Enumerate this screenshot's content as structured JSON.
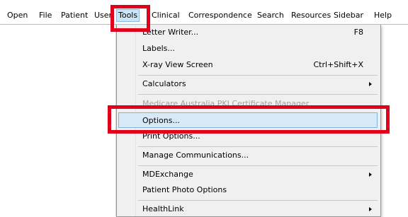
{
  "menubar": {
    "items": [
      "Open",
      "File",
      "Patient",
      "User",
      "Tools",
      "Clinical",
      "Correspondence",
      "Search",
      "Resources",
      "Sidebar",
      "Help"
    ]
  },
  "tools_menu": {
    "letter_writer": {
      "label": "Letter Writer...",
      "shortcut": "F8"
    },
    "labels": {
      "label": "Labels..."
    },
    "xray_view": {
      "label": "X-ray View Screen",
      "shortcut": "Ctrl+Shift+X"
    },
    "calculators": {
      "label": "Calculators"
    },
    "medicare_pki": {
      "label": "Medicare Australia PKI Certificate Manager"
    },
    "options": {
      "label": "Options..."
    },
    "print_options": {
      "label": "Print Options..."
    },
    "manage_comms": {
      "label": "Manage Communications..."
    },
    "mdexchange": {
      "label": "MDExchange"
    },
    "patient_photo": {
      "label": "Patient Photo Options"
    },
    "healthlink": {
      "label": "HealthLink"
    }
  },
  "colors": {
    "annotation": "#e0001b",
    "highlight_bg": "#d8e9f8",
    "menu_bg": "#f0f0f0"
  }
}
